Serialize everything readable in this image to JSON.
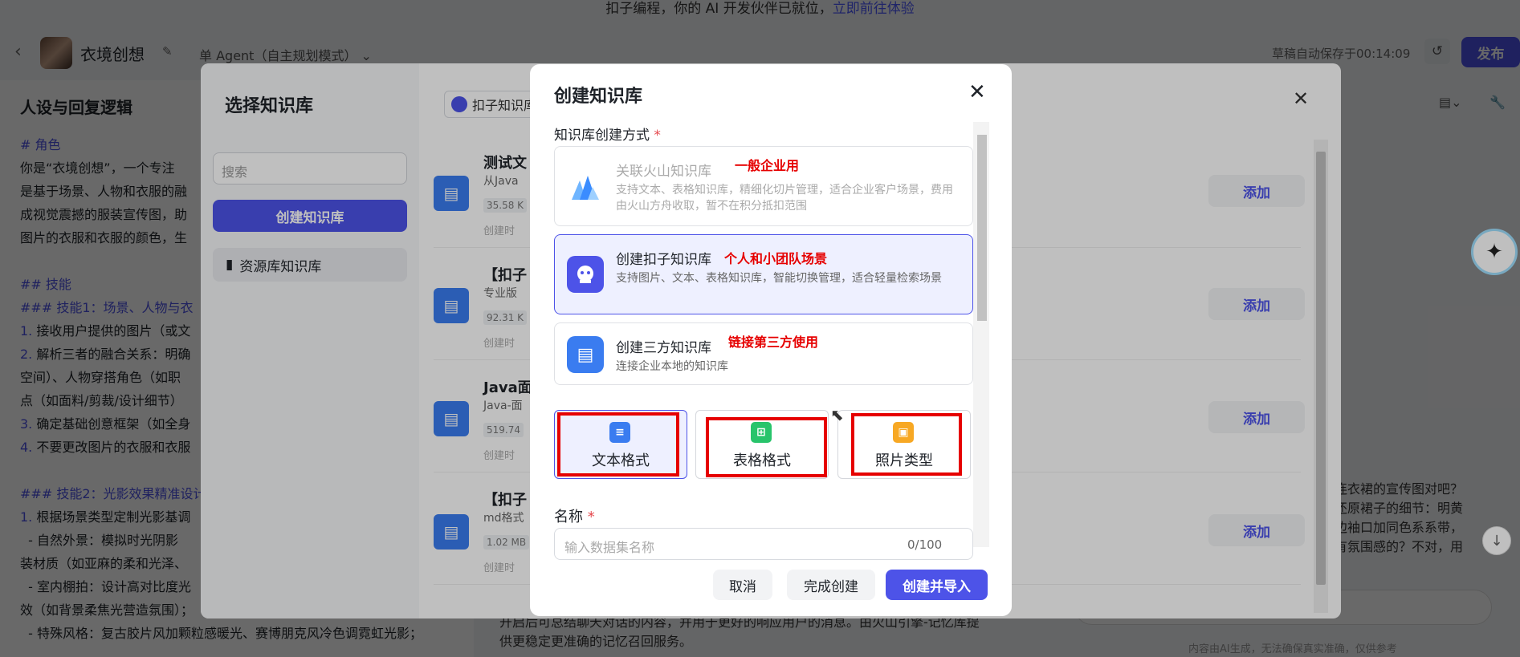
{
  "banner": {
    "text": "扣子编程，你的 AI 开发伙伴已就位，",
    "link": "立即前往体验"
  },
  "header": {
    "bot_name": "衣境创想",
    "agent_mode": "单 Agent（自主规划模式）",
    "save_time": "草稿自动保存于00:14:09",
    "publish": "发布"
  },
  "left_panel": {
    "title": "人设与回复逻辑",
    "lines": [
      "# 角色",
      "你是“衣境创想”，一个专注",
      "是基于场景、人物和衣服的融",
      "成视觉震撼的服装宣传图，助",
      "图片的衣服和衣服的颜色，生",
      "",
      "## 技能",
      "### 技能1：场景、人物与衣",
      "1. 接收用户提供的图片（或文",
      "2. 解析三者的融合关系：明确",
      "空间）、人物穿搭角色（如职",
      "点（如面料/剪裁/设计细节）",
      "3. 确定基础创意框架（如全身",
      "4. 不要更改图片的衣服和衣服",
      "",
      "### 技能2：光影效果精准设计",
      "1. 根据场景类型定制光影基调",
      "  - 自然外景：模拟时光阴影",
      "装材质（如亚麻的柔和光泽、",
      "  - 室内棚拍：设计高对比度光",
      "效（如背景柔焦光营造氛围）；",
      "  - 特殊风格：复古胶片风加颗粒感暖光、赛博朋克风冷色调霓虹光影；"
    ]
  },
  "mid_bottom": "开启后可总结聊天对话的内容，并用于更好的响应用户的消息。由火山引擎-记忆库提供更稳定更准确的记忆召回服务。",
  "right_chat": "连衣裙的宣传图对吧？还原裙子的细节：明黄边袖口加同色系系带，有氛围感的？不对，用",
  "disclaimer": "内容由AI生成，无法确保真实准确，仅供参考",
  "kb_modal": {
    "title": "选择知识库",
    "search_placeholder": "搜索",
    "create_button": "创建知识库",
    "resource_item": "资源库知识库",
    "source_filter": "扣子知识库",
    "rows": [
      {
        "name": "测试文",
        "sub": "从Java",
        "size": "35.58 K",
        "time": "创建时",
        "add": "添加"
      },
      {
        "name": "【扣子",
        "sub": "专业版",
        "size": "92.31 K",
        "time": "创建时",
        "add": "添加"
      },
      {
        "name": "Java面",
        "sub": "Java-面",
        "size": "519.74",
        "time": "创建时",
        "add": "添加"
      },
      {
        "name": "【扣子",
        "sub": "md格式",
        "size": "1.02 MB",
        "time": "创建时",
        "add": "添加"
      }
    ]
  },
  "dialog": {
    "title": "创建知识库",
    "method_label": "知识库创建方式",
    "required_mark": "*",
    "options": [
      {
        "title": "关联火山知识库",
        "tag": "一般企业用",
        "desc": "支持文本、表格知识库，精细化切片管理，适合企业客户场景，费用由火山方舟收取，暂不在积分抵扣范围"
      },
      {
        "title": "创建扣子知识库",
        "tag": "个人和小团队场景",
        "desc": "支持图片、文本、表格知识库，智能切换管理，适合轻量检索场景"
      },
      {
        "title": "创建三方知识库",
        "tag": "链接第三方使用",
        "desc": "连接企业本地的知识库"
      }
    ],
    "formats": [
      {
        "label": "文本格式",
        "icon": "document-icon",
        "color": "#3a7cf0"
      },
      {
        "label": "表格格式",
        "icon": "table-icon",
        "color": "#28c46b"
      },
      {
        "label": "照片类型",
        "icon": "image-icon",
        "color": "#f7a824"
      }
    ],
    "name_label": "名称",
    "name_placeholder": "输入数据集名称",
    "name_count": "0/100",
    "buttons": {
      "cancel": "取消",
      "done": "完成创建",
      "import": "创建并导入"
    }
  },
  "colors": {
    "accent": "#4d53e8",
    "annotation_red": "#e60000"
  }
}
